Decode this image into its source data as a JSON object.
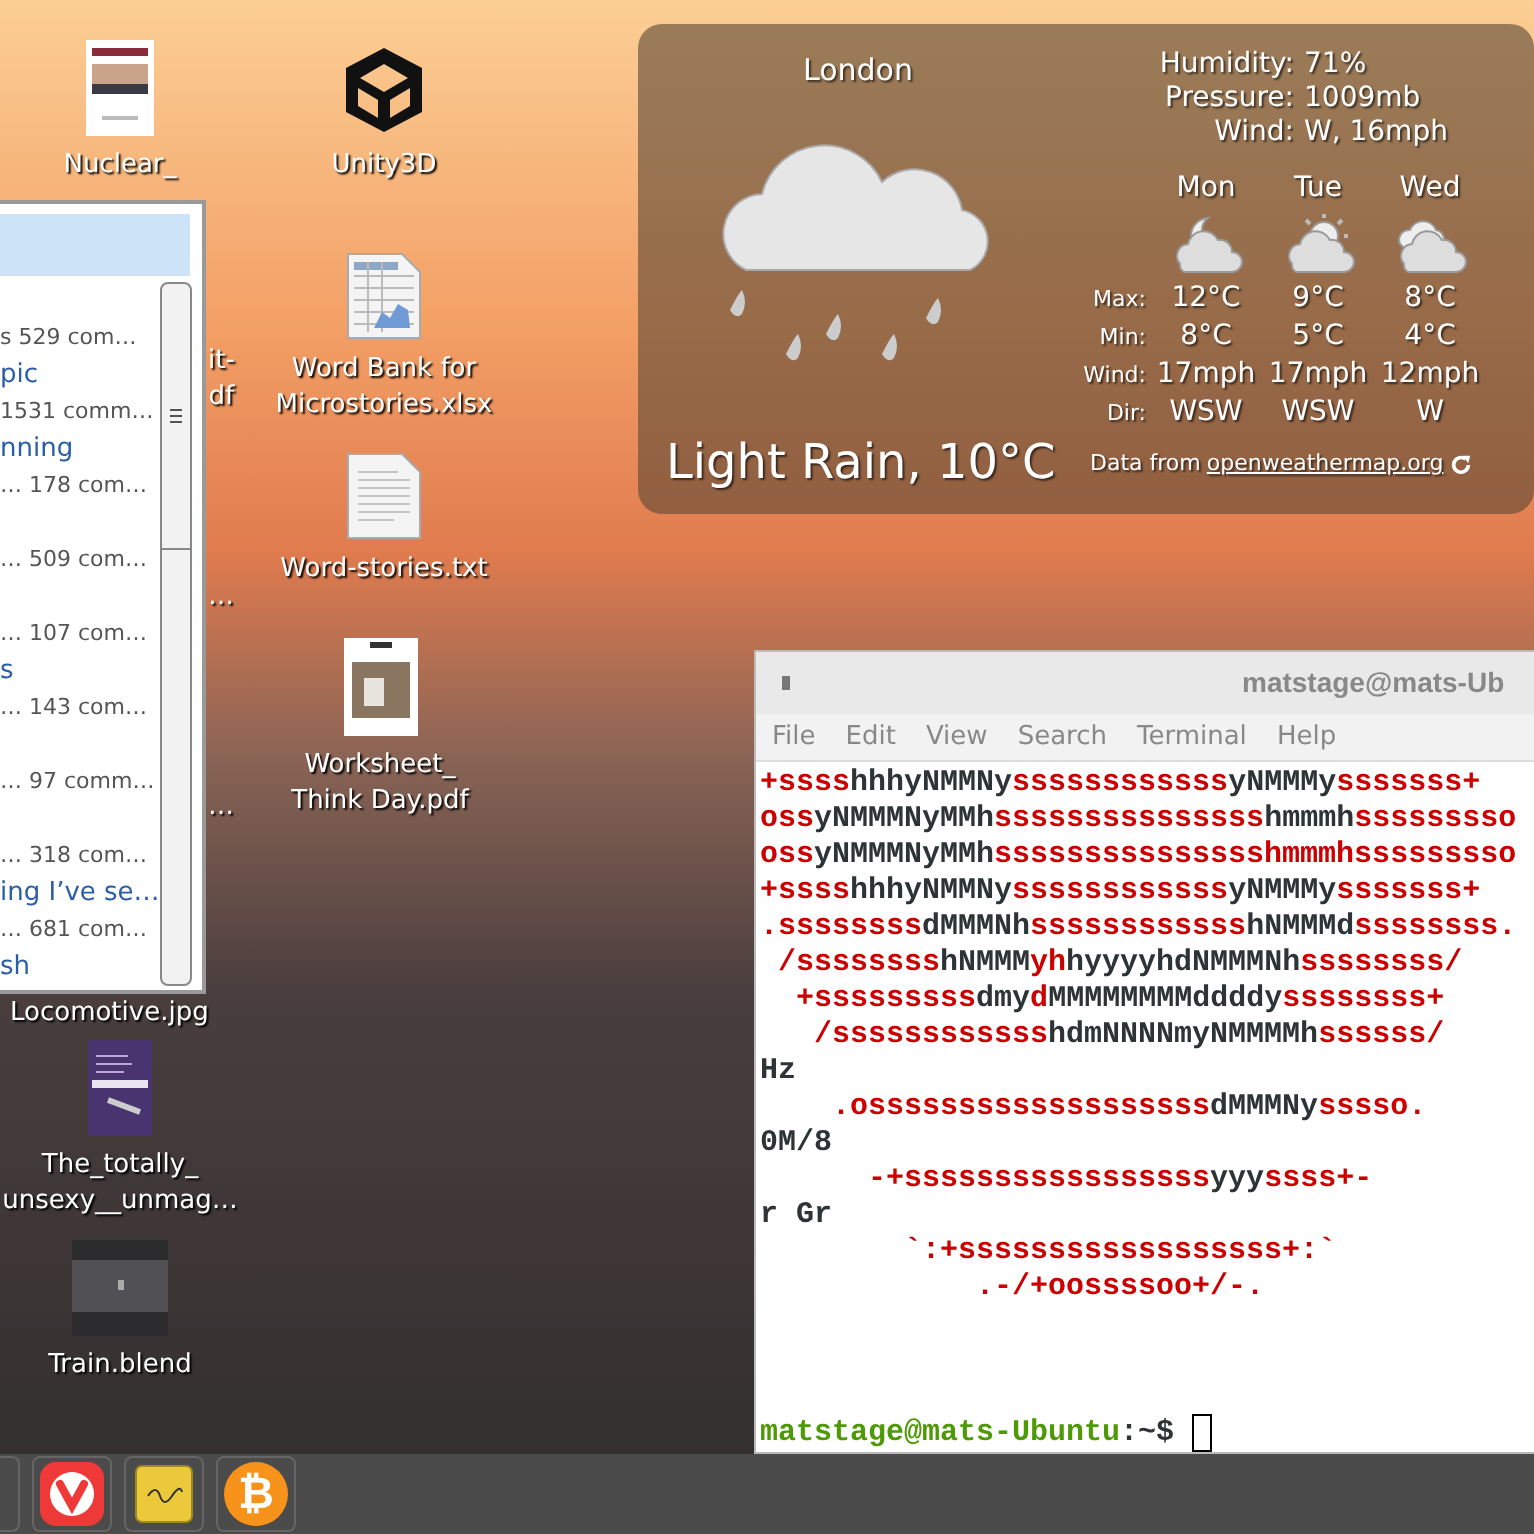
{
  "desktop_icons": [
    {
      "kind": "pdf-cover",
      "label": "Nuclear_"
    },
    {
      "kind": "unity",
      "label": "Unity3D"
    },
    {
      "kind": "covered",
      "label": "it-\ndf"
    },
    {
      "kind": "spreadsheet",
      "label": "Word Bank for\nMicrostories.xlsx"
    },
    {
      "kind": "text-file",
      "label": "Word-stories.txt"
    },
    {
      "kind": "covered",
      "label": "…"
    },
    {
      "kind": "covered",
      "label": "…"
    },
    {
      "kind": "pdf-photo",
      "label": "Worksheet_\nThink Day.pdf"
    },
    {
      "kind": "covered",
      "label": "Locomotive.jpg"
    },
    {
      "kind": "pdf-purple",
      "label": "The_totally_\nunsexy__unmag…"
    },
    {
      "kind": "blend",
      "label": "Train.blend"
    }
  ],
  "feed_window": {
    "items": [
      {
        "detail": "s 529 com…"
      },
      {
        "title": "pic",
        "detail": "1531 comm…"
      },
      {
        "title": "nning",
        "detail": "… 178 com…"
      },
      {
        "detail": "… 509 com…"
      },
      {
        "detail": "… 107 com…"
      },
      {
        "title": "s",
        "detail": "… 143 com…"
      },
      {
        "detail": "… 97 comm…"
      },
      {
        "detail": "… 318 com…"
      },
      {
        "title": "ing I’ve se…",
        "detail": "… 681 com…"
      },
      {
        "title": "sh"
      }
    ]
  },
  "weather": {
    "city": "London",
    "current": "Light Rain, 10°C",
    "details": [
      {
        "label": "Humidity:",
        "value": "71%"
      },
      {
        "label": "Pressure:",
        "value": "1009mb"
      },
      {
        "label": "Wind:",
        "value": "W, 16mph"
      }
    ],
    "days": [
      {
        "name": "Mon",
        "kind": "night"
      },
      {
        "name": "Tue",
        "kind": "sunny"
      },
      {
        "name": "Wed",
        "kind": "cloudy"
      }
    ],
    "rows": [
      {
        "label": "Max:",
        "values": [
          "12°C",
          "9°C",
          "8°C"
        ]
      },
      {
        "label": "Min:",
        "values": [
          "8°C",
          "5°C",
          "4°C"
        ]
      },
      {
        "label": "Wind:",
        "values": [
          "17mph",
          "17mph",
          "12mph"
        ]
      },
      {
        "label": "Dir:",
        "values": [
          "WSW",
          "WSW",
          "W"
        ]
      }
    ],
    "credit": "Data from",
    "link": "openweathermap.org"
  },
  "terminal": {
    "title": "matstage@mats-Ub",
    "menu": [
      "File",
      "Edit",
      "View",
      "Search",
      "Terminal",
      "Help"
    ],
    "lines": [
      [
        {
          "text": "+ssss",
          "color": "#cc0000"
        },
        {
          "text": "hhhyNMMNy",
          "color": "#2e3436"
        },
        {
          "text": "ssssssssssss",
          "color": "#cc0000"
        },
        {
          "text": "yNMMMy",
          "color": "#2e3436"
        },
        {
          "text": "sssssss+",
          "color": "#cc0000"
        }
      ],
      [
        {
          "text": "oss",
          "color": "#cc0000"
        },
        {
          "text": "yNMMMNyMMh",
          "color": "#2e3436"
        },
        {
          "text": "sssssssssssssss",
          "color": "#cc0000"
        },
        {
          "text": "hmmmh",
          "color": "#2e3436"
        },
        {
          "text": "sssssssso",
          "color": "#cc0000"
        }
      ],
      [
        {
          "text": "oss",
          "color": "#cc0000"
        },
        {
          "text": "yNMMMNyMMh",
          "color": "#2e3436"
        },
        {
          "text": "ssssssssssssssshmmmhsssssssso",
          "color": "#cc0000"
        }
      ],
      [
        {
          "text": "+ssss",
          "color": "#cc0000"
        },
        {
          "text": "hhhyNMMNy",
          "color": "#2e3436"
        },
        {
          "text": "ssssssssssss",
          "color": "#cc0000"
        },
        {
          "text": "yNMMMy",
          "color": "#2e3436"
        },
        {
          "text": "sssssss+",
          "color": "#cc0000"
        }
      ],
      [
        {
          "text": ".ssssssss",
          "color": "#cc0000"
        },
        {
          "text": "dMMMNh",
          "color": "#2e3436"
        },
        {
          "text": "ssssssssssss",
          "color": "#cc0000"
        },
        {
          "text": "hNMMMd",
          "color": "#2e3436"
        },
        {
          "text": "ssssssss.",
          "color": "#cc0000"
        }
      ],
      [
        {
          "text": " /ssssssss",
          "color": "#cc0000"
        },
        {
          "text": "hNMMM",
          "color": "#2e3436"
        },
        {
          "text": "yh",
          "color": "#cc0000"
        },
        {
          "text": "hyyyyhdNMMMNh",
          "color": "#2e3436"
        },
        {
          "text": "ssssssss/",
          "color": "#cc0000"
        }
      ],
      [
        {
          "text": "  +sssssssss",
          "color": "#cc0000"
        },
        {
          "text": "dmy",
          "color": "#2e3436"
        },
        {
          "text": "d",
          "color": "#cc0000"
        },
        {
          "text": "MMMMMMMMddddy",
          "color": "#2e3436"
        },
        {
          "text": "ssssssss+",
          "color": "#cc0000"
        }
      ],
      [
        {
          "text": "   /ssssssssssss",
          "color": "#cc0000"
        },
        {
          "text": "hdmNNNNmyNMMMMh",
          "color": "#2e3436"
        },
        {
          "text": "ssssss/",
          "color": "#cc0000"
        }
      ],
      [
        {
          "text": "Hz",
          "color": "#2e3436"
        }
      ],
      [
        {
          "text": "    .osssssssssssssssssss",
          "color": "#cc0000"
        },
        {
          "text": "dMMMNy",
          "color": "#2e3436"
        },
        {
          "text": "sssso.",
          "color": "#cc0000"
        }
      ],
      [
        {
          "text": "0M/8",
          "color": "#2e3436"
        }
      ],
      [
        {
          "text": "      -+sssssssssssssssss",
          "color": "#cc0000"
        },
        {
          "text": "yyy",
          "color": "#2e3436"
        },
        {
          "text": "ssss+-",
          "color": "#cc0000"
        }
      ],
      [
        {
          "text": "r Gr",
          "color": "#2e3436"
        }
      ],
      [
        {
          "text": "        `:+ssssssssssssssssss+:`",
          "color": "#cc0000"
        }
      ],
      [
        {
          "text": "            .-/+oossssoo+/-.",
          "color": "#cc0000"
        }
      ]
    ],
    "prompt": [
      {
        "text": "matstage@mats-Ubuntu",
        "color": "#4e9a06"
      },
      {
        "text": ":~$",
        "color": "#2e3436"
      }
    ]
  },
  "taskbar": [
    {
      "kind": "partial"
    },
    {
      "kind": "browser"
    },
    {
      "kind": "notes"
    },
    {
      "kind": "bitcoin",
      "glyph": "₿"
    }
  ]
}
